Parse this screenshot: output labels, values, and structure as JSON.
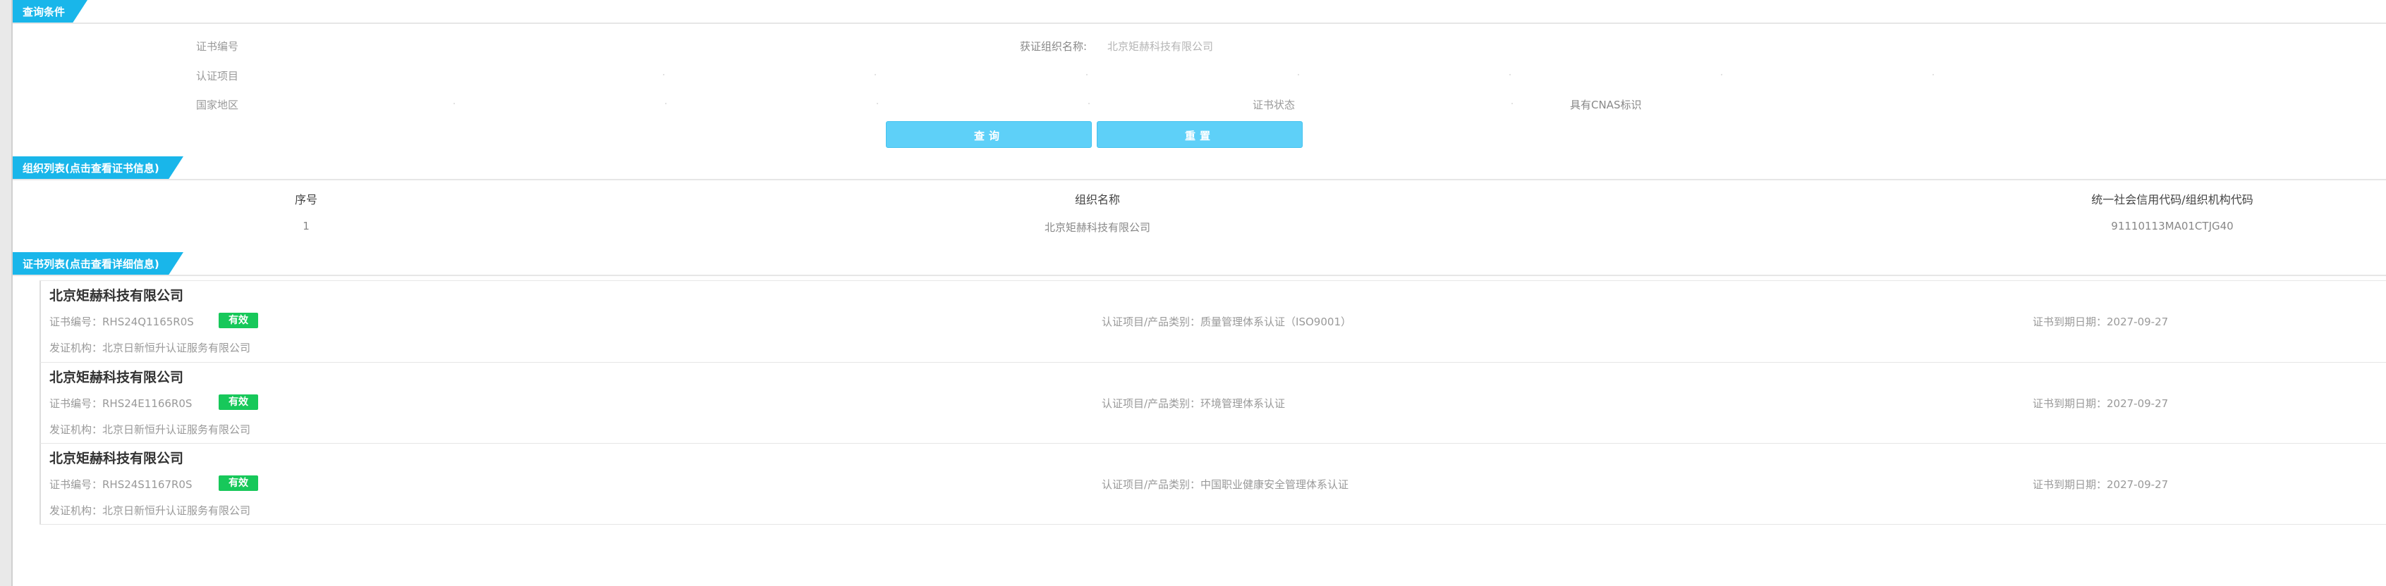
{
  "sections": {
    "query": "查询条件",
    "org_list": "组织列表(点击查看证书信息)",
    "cert_list": "证书列表(点击查看详细信息)"
  },
  "form": {
    "cert_no_label": "证书编号",
    "org_name_label": "获证组织名称:",
    "org_name_value": "北京矩赫科技有限公司",
    "cert_item_label": "认证项目",
    "country_label": "国家地区",
    "cert_status_label": "证书状态",
    "cnas_label": "具有CNAS标识"
  },
  "buttons": {
    "query": "查询",
    "reset": "重置"
  },
  "org_table": {
    "headers": [
      "序号",
      "组织名称",
      "统一社会信用代码/组织机构代码"
    ],
    "rows": [
      [
        "1",
        "北京矩赫科技有限公司",
        "91110113MA01CTJG40"
      ]
    ]
  },
  "certificates": [
    {
      "org": "北京矩赫科技有限公司",
      "cert_no": "证书编号：RHS24Q1165R0S",
      "status": "有效",
      "item": "认证项目/产品类别：质量管理体系认证（ISO9001）",
      "expiry": "证书到期日期：2027-09-27",
      "issuer": "发证机构：北京日新恒升认证服务有限公司"
    },
    {
      "org": "北京矩赫科技有限公司",
      "cert_no": "证书编号：RHS24E1166R0S",
      "status": "有效",
      "item": "认证项目/产品类别：环境管理体系认证",
      "expiry": "证书到期日期：2027-09-27",
      "issuer": "发证机构：北京日新恒升认证服务有限公司"
    },
    {
      "org": "北京矩赫科技有限公司",
      "cert_no": "证书编号：RHS24S1167R0S",
      "status": "有效",
      "item": "认证项目/产品类别：中国职业健康安全管理体系认证",
      "expiry": "证书到期日期：2027-09-27",
      "issuer": "发证机构：北京日新恒升认证服务有限公司"
    }
  ],
  "colors": {
    "accent": "#19b6ea",
    "button": "#5ed0f8",
    "valid_badge": "#17c85a"
  }
}
